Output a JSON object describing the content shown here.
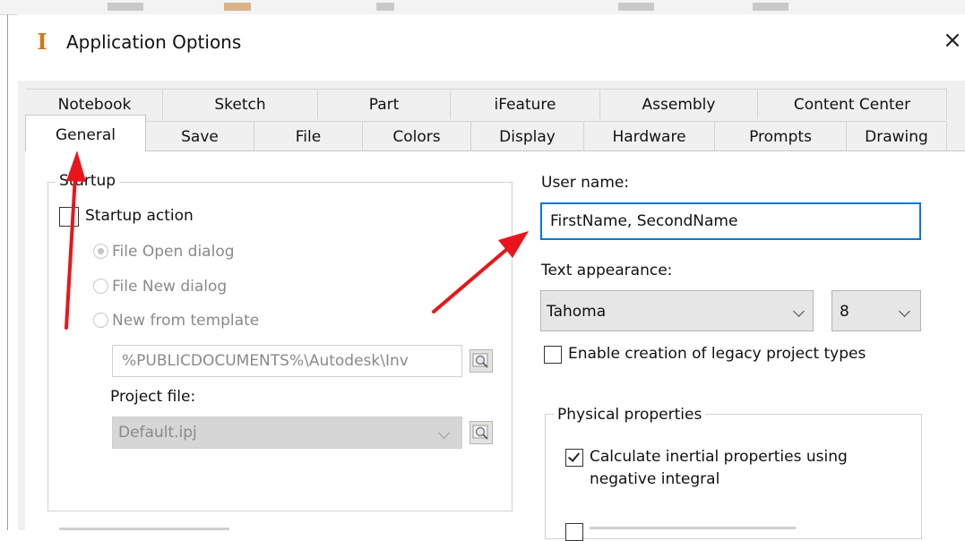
{
  "dialog": {
    "title": "Application Options",
    "close_glyph": "×",
    "icon": "inventor-app-icon"
  },
  "tabs": {
    "row1": [
      "Notebook",
      "Sketch",
      "Part",
      "iFeature",
      "Assembly",
      "Content Center"
    ],
    "row2": [
      "General",
      "Save",
      "File",
      "Colors",
      "Display",
      "Hardware",
      "Prompts",
      "Drawing"
    ],
    "selected": "General"
  },
  "startup": {
    "group_label": "Startup",
    "startup_action_label": "Startup action",
    "startup_action_checked": false,
    "radio_options": [
      "File Open dialog",
      "File New dialog",
      "New from template"
    ],
    "radio_selected": "File Open dialog",
    "template_path": "%PUBLICDOCUMENTS%\\Autodesk\\Inv",
    "project_file_label": "Project file:",
    "project_file_value": "Default.ipj"
  },
  "user": {
    "label": "User name:",
    "value": "FirstName, SecondName"
  },
  "text_appearance": {
    "label": "Text appearance:",
    "font": "Tahoma",
    "size": "8"
  },
  "legacy": {
    "label": "Enable creation of legacy project types",
    "checked": false
  },
  "physical": {
    "group_label": "Physical properties",
    "calc_label_line1": "Calculate inertial properties using",
    "calc_label_line2": "negative integral",
    "calc_checked": true
  },
  "colors": {
    "accent": "#0078d7",
    "arrow": "#e8161c",
    "icon": "#d2781b"
  }
}
